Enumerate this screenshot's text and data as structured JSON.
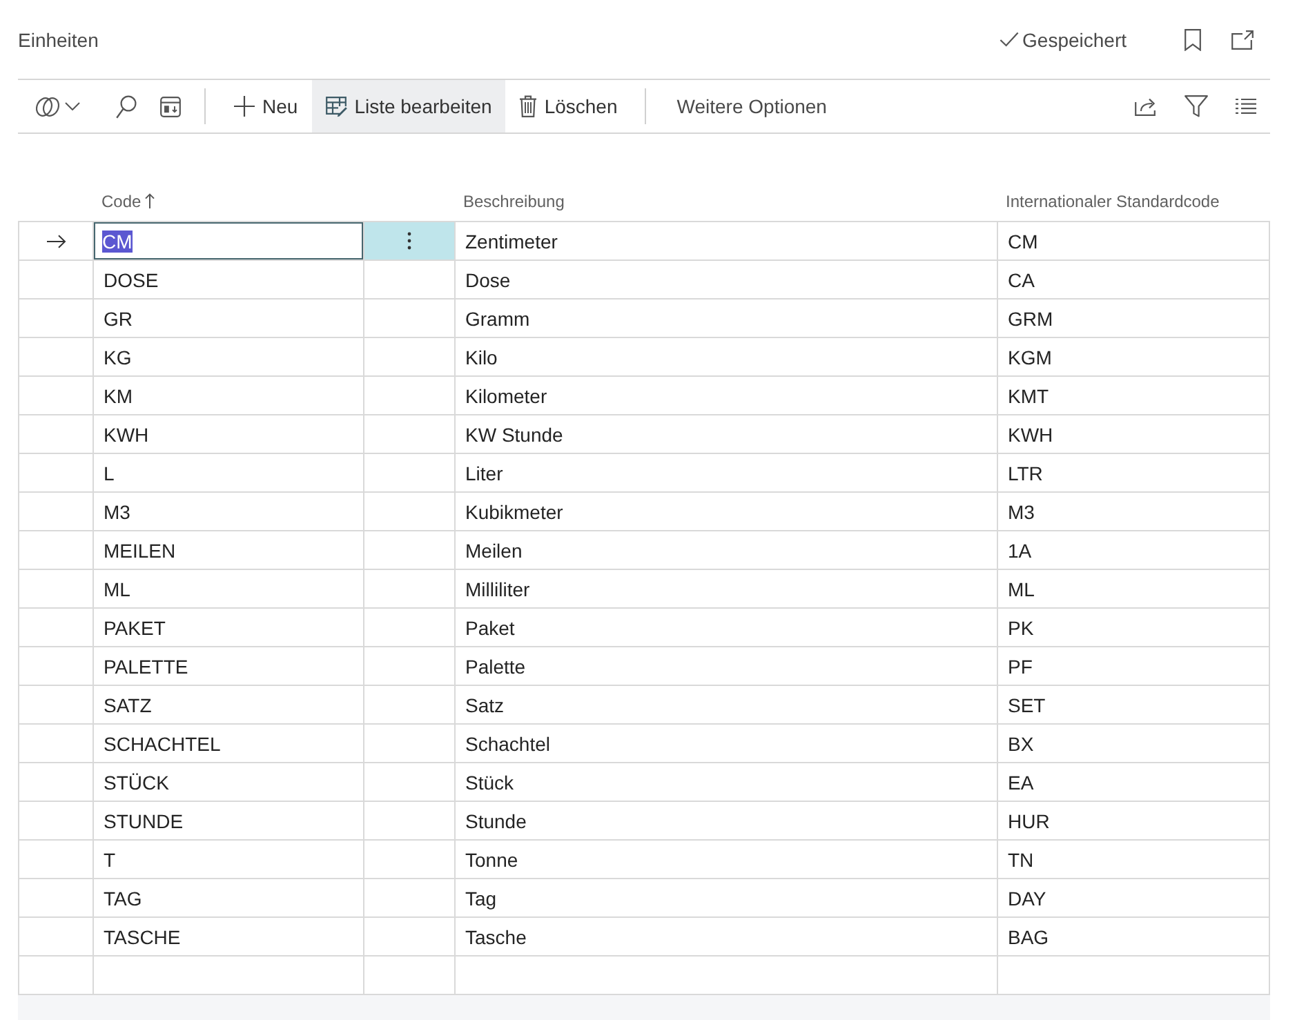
{
  "page": {
    "title": "Einheiten",
    "save_status": "Gespeichert"
  },
  "toolbar": {
    "actions": [
      {
        "kind": "new",
        "label": "Neu",
        "active": false
      },
      {
        "kind": "edit_list",
        "label": "Liste bearbeiten",
        "active": true
      },
      {
        "kind": "delete",
        "label": "Löschen",
        "active": false
      }
    ],
    "more_options": "Weitere Optionen"
  },
  "table": {
    "columns": [
      {
        "label": "Code",
        "sorted": true
      },
      {
        "label": "Beschreibung",
        "sorted": false
      },
      {
        "label": "Internationaler Standardcode",
        "sorted": false
      }
    ],
    "rows": [
      {
        "code": "CM",
        "description": "Zentimeter",
        "standard_code": "CM",
        "selected": true
      },
      {
        "code": "DOSE",
        "description": "Dose",
        "standard_code": "CA",
        "selected": false
      },
      {
        "code": "GR",
        "description": "Gramm",
        "standard_code": "GRM",
        "selected": false
      },
      {
        "code": "KG",
        "description": "Kilo",
        "standard_code": "KGM",
        "selected": false
      },
      {
        "code": "KM",
        "description": "Kilometer",
        "standard_code": "KMT",
        "selected": false
      },
      {
        "code": "KWH",
        "description": "KW Stunde",
        "standard_code": "KWH",
        "selected": false
      },
      {
        "code": "L",
        "description": "Liter",
        "standard_code": "LTR",
        "selected": false
      },
      {
        "code": "M3",
        "description": "Kubikmeter",
        "standard_code": "M3",
        "selected": false
      },
      {
        "code": "MEILEN",
        "description": "Meilen",
        "standard_code": "1A",
        "selected": false
      },
      {
        "code": "ML",
        "description": "Milliliter",
        "standard_code": "ML",
        "selected": false
      },
      {
        "code": "PAKET",
        "description": "Paket",
        "standard_code": "PK",
        "selected": false
      },
      {
        "code": "PALETTE",
        "description": "Palette",
        "standard_code": "PF",
        "selected": false
      },
      {
        "code": "SATZ",
        "description": "Satz",
        "standard_code": "SET",
        "selected": false
      },
      {
        "code": "SCHACHTEL",
        "description": "Schachtel",
        "standard_code": "BX",
        "selected": false
      },
      {
        "code": "STÜCK",
        "description": "Stück",
        "standard_code": "EA",
        "selected": false
      },
      {
        "code": "STUNDE",
        "description": "Stunde",
        "standard_code": "HUR",
        "selected": false
      },
      {
        "code": "T",
        "description": "Tonne",
        "standard_code": "TN",
        "selected": false
      },
      {
        "code": "TAG",
        "description": "Tag",
        "standard_code": "DAY",
        "selected": false
      },
      {
        "code": "TASCHE",
        "description": "Tasche",
        "standard_code": "BAG",
        "selected": false
      }
    ]
  }
}
